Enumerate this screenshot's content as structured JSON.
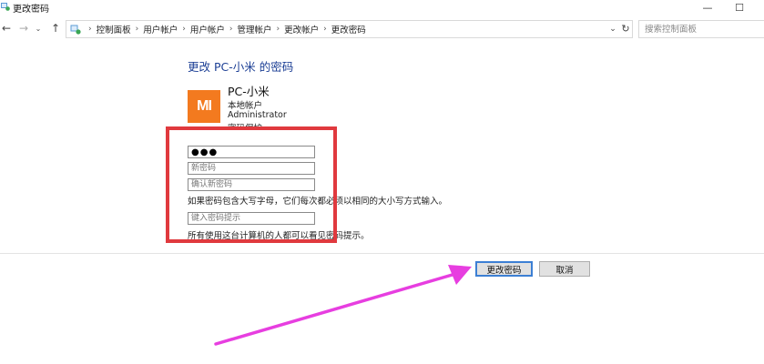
{
  "window": {
    "title": "更改密码",
    "minimize_glyph": "—",
    "maximize_glyph": "☐"
  },
  "nav": {
    "back_glyph": "←",
    "forward_glyph": "→",
    "recent_glyph": "⌄",
    "up_glyph": "↑",
    "breadcrumbs": [
      "控制面板",
      "用户帐户",
      "用户帐户",
      "管理帐户",
      "更改帐户",
      "更改密码"
    ],
    "separator": "›",
    "dropdown_glyph": "⌄",
    "refresh_glyph": "↻",
    "search_placeholder": "搜索控制面板"
  },
  "page": {
    "heading": "更改 PC-小米 的密码",
    "account": {
      "logo_text": "MI",
      "name": "PC-小米",
      "type": "本地帐户",
      "role": "Administrator",
      "protection": "密码保护"
    },
    "fields": {
      "current_password_value": "●●●",
      "new_password_placeholder": "新密码",
      "confirm_password_placeholder": "确认新密码",
      "hint_placeholder": "键入密码提示"
    },
    "case_note": "如果密码包含大写字母，它们每次都必须以相同的大小写方式输入。",
    "hint_note": "所有使用这台计算机的人都可以看见密码提示。",
    "buttons": {
      "change": "更改密码",
      "cancel": "取消"
    }
  },
  "colors": {
    "heading": "#1c3f95",
    "brand_orange": "#f37a1f",
    "highlight_red": "#e0393e",
    "arrow_magenta": "#e73ee0",
    "button_focus": "#3c7fd4"
  },
  "icons": {
    "title": "control-panel-icon",
    "address": "control-panel-icon",
    "search": "search-icon",
    "refresh": "refresh-icon"
  }
}
